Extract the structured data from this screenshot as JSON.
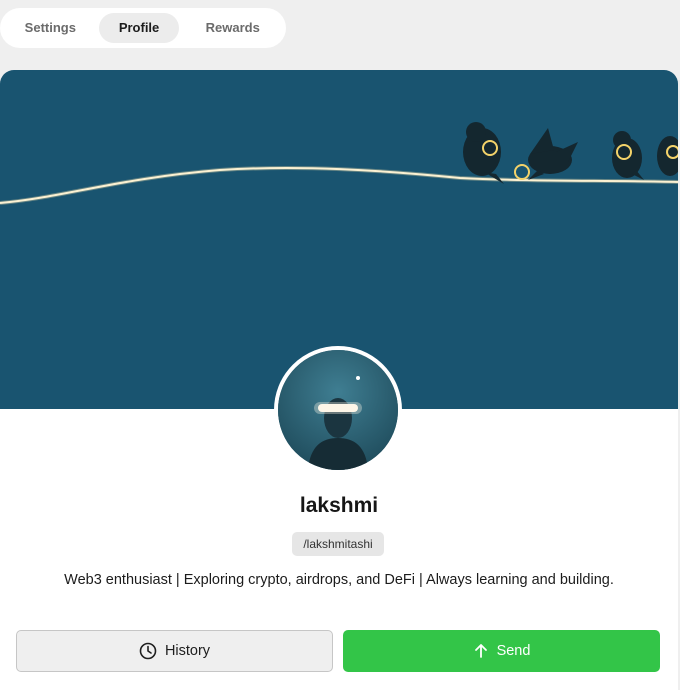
{
  "tabs": [
    {
      "label": "Settings",
      "active": false
    },
    {
      "label": "Profile",
      "active": true
    },
    {
      "label": "Rewards",
      "active": false
    }
  ],
  "profile": {
    "name": "lakshmi",
    "handle": "/lakshmitashi",
    "bio": "Web3 enthusiast | Exploring crypto, airdrops, and DeFi | Always learning and building."
  },
  "actions": {
    "history_label": "History",
    "history_icon": "clock-icon",
    "send_label": "Send",
    "send_icon": "arrow-up-icon"
  },
  "colors": {
    "banner_bg": "#1c5b78",
    "send_green": "#33c548",
    "page_bg": "#efefef"
  }
}
